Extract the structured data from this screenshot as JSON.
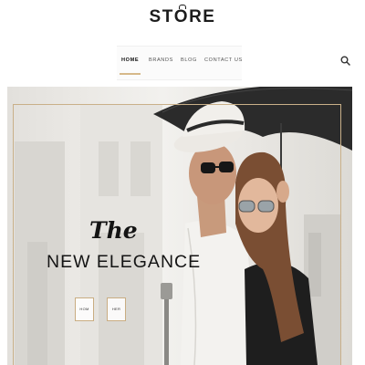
{
  "header": {
    "logo": {
      "prefix": "ST",
      "o": "O",
      "suffix": "RE"
    }
  },
  "nav": {
    "items": [
      {
        "label": "HOME",
        "active": true
      },
      {
        "label": "BRANDS"
      },
      {
        "label": "BLOG"
      },
      {
        "label": "CONTACT US"
      }
    ],
    "search_icon": "search-icon",
    "accent_color": "#d6b889"
  },
  "hero": {
    "headline_script": "The",
    "headline_main": "NEW ELEGANCE",
    "buttons": [
      {
        "label": "HOM"
      },
      {
        "label": "HER"
      }
    ]
  }
}
